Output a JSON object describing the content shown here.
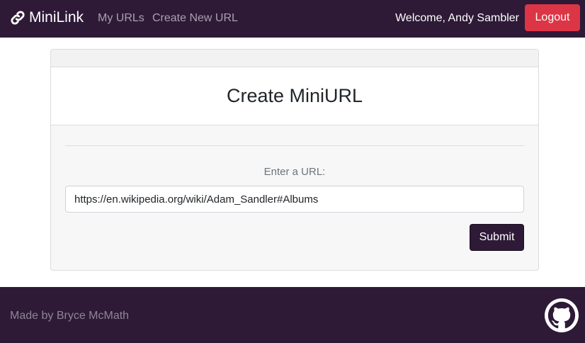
{
  "navbar": {
    "brand": "MiniLink",
    "links": [
      "My URLs",
      "Create New URL"
    ],
    "welcome": "Welcome, Andy Sambler",
    "logout_label": "Logout"
  },
  "card": {
    "title": "Create MiniURL",
    "url_label": "Enter a URL:",
    "url_value": "https://en.wikipedia.org/wiki/Adam_Sandler#Albums",
    "submit_label": "Submit"
  },
  "footer": {
    "text": "Made by Bryce McMath",
    "github_icon": "github-icon"
  },
  "colors": {
    "navbar_bg": "#2e1a37",
    "logout_bg": "#dc3545",
    "submit_bg": "#2e1a37"
  }
}
